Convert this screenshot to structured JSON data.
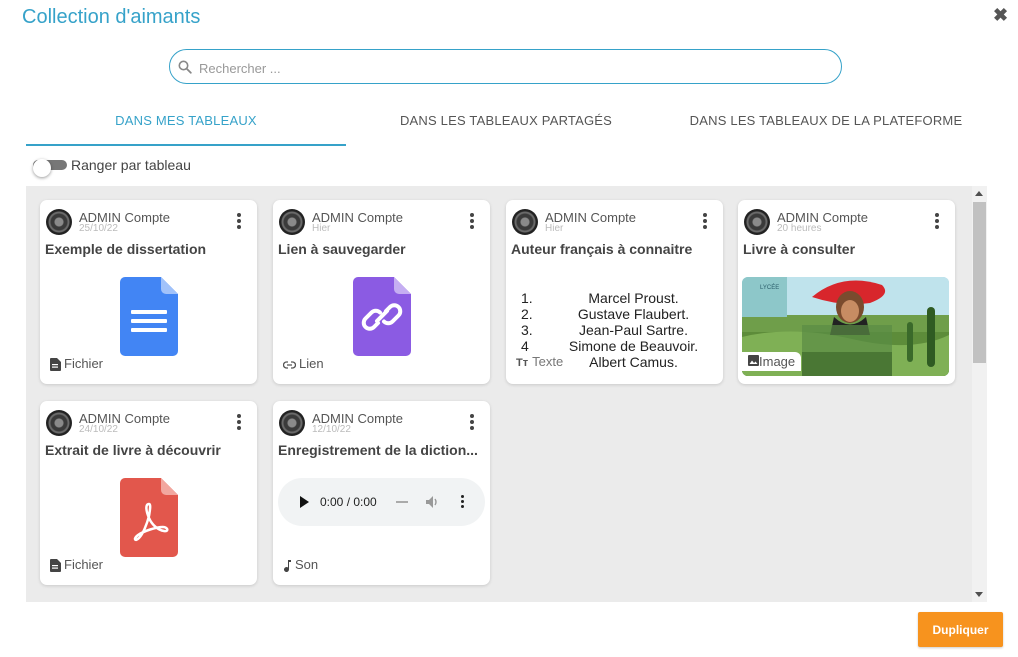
{
  "dialog": {
    "title": "Collection d'aimants"
  },
  "search": {
    "placeholder": "Rechercher ..."
  },
  "tabs": [
    {
      "label": "DANS MES TABLEAUX",
      "active": true
    },
    {
      "label": "DANS LES TABLEAUX PARTAGÉS",
      "active": false
    },
    {
      "label": "DANS LES TABLEAUX DE LA PLATEFORME",
      "active": false
    }
  ],
  "toggle": {
    "label": "Ranger par tableau",
    "on": false
  },
  "cards": [
    {
      "author": "ADMIN Compte",
      "date": "25/10/22",
      "title": "Exemple de dissertation",
      "type_label": "Fichier",
      "icon": "google-docs-icon"
    },
    {
      "author": "ADMIN Compte",
      "date": "Hier",
      "title": "Lien à sauvegarder",
      "type_label": "Lien",
      "icon": "link-file-icon"
    },
    {
      "author": "ADMIN Compte",
      "date": "Hier",
      "title": "Auteur français à connaitre",
      "type_label": "Texte",
      "icon": "text-icon",
      "list": [
        {
          "n": "1.",
          "t": "Marcel Proust."
        },
        {
          "n": "2.",
          "t": "Gustave Flaubert."
        },
        {
          "n": "3.",
          "t": "Jean-Paul Sartre."
        },
        {
          "n": "4",
          "t": "Simone de Beauvoir."
        },
        {
          "n": "",
          "t": "Albert Camus."
        }
      ]
    },
    {
      "author": "ADMIN Compte",
      "date": "20 heures",
      "title": "Livre à consulter",
      "type_label": "Image",
      "icon": "image-icon"
    },
    {
      "author": "ADMIN Compte",
      "date": "24/10/22",
      "title": "Extrait de livre à découvrir",
      "type_label": "Fichier",
      "icon": "pdf-file-icon"
    },
    {
      "author": "ADMIN Compte",
      "date": "12/10/22",
      "title": "Enregistrement de la diction...",
      "type_label": "Son",
      "icon": "music-note-icon",
      "audio_time": "0:00 / 0:00"
    }
  ],
  "footer": {
    "duplicate_label": "Dupliquer"
  },
  "colors": {
    "accent": "#36a2c9",
    "button": "#f7931e",
    "docs_blue": "#4285f4",
    "link_purple": "#8b5be3",
    "pdf_red": "#e2574c"
  }
}
